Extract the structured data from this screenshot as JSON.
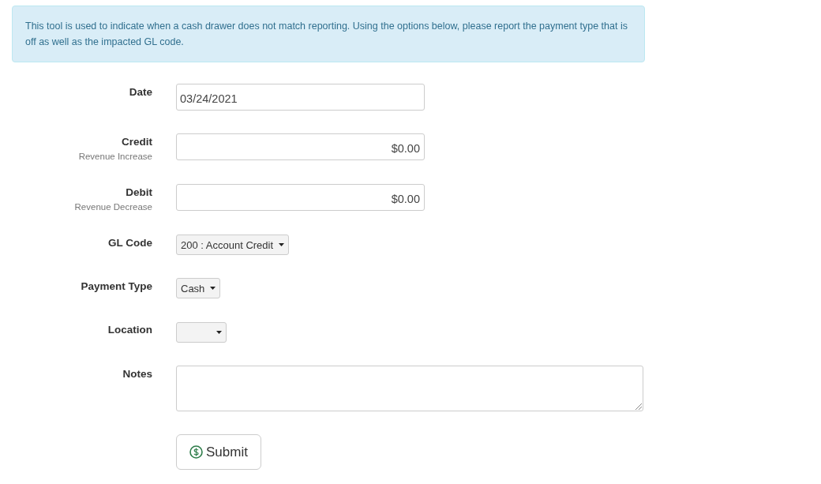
{
  "alert": {
    "text": "This tool is used to indicate when a cash drawer does not match reporting. Using the options below, please report the payment type that is off as well as the impacted GL code."
  },
  "fields": [
    {
      "kind": "text",
      "label": "Date",
      "value": "03/24/2021"
    },
    {
      "kind": "money",
      "label": "Credit",
      "sublabel": "Revenue Increase",
      "value": "$0.00"
    },
    {
      "kind": "money",
      "label": "Debit",
      "sublabel": "Revenue Decrease",
      "value": "$0.00"
    },
    {
      "kind": "select",
      "label": "GL Code",
      "value": "200 : Account Credit"
    },
    {
      "kind": "select",
      "label": "Payment Type",
      "value": "Cash"
    },
    {
      "kind": "select",
      "label": "Location"
    },
    {
      "kind": "textarea",
      "label": "Notes"
    }
  ],
  "submit": {
    "label": "Submit"
  }
}
